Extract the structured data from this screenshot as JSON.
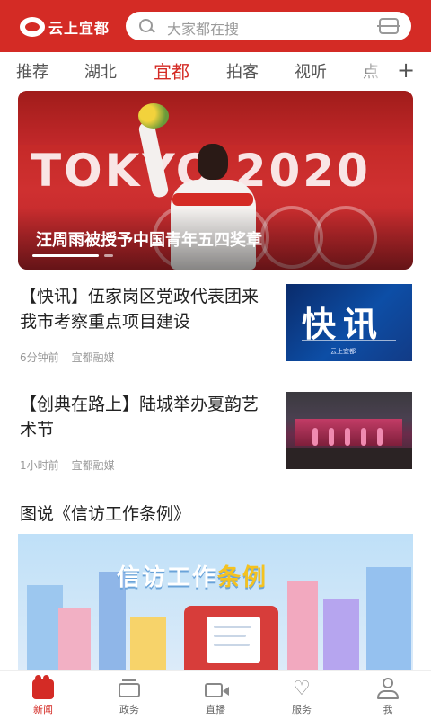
{
  "header": {
    "logo_text": "云上宜都",
    "search_placeholder": "大家都在搜",
    "brand_color": "#d42b25"
  },
  "tabs": [
    {
      "label": "推荐",
      "active": false
    },
    {
      "label": "湖北",
      "active": false
    },
    {
      "label": "宜都",
      "active": true
    },
    {
      "label": "拍客",
      "active": false
    },
    {
      "label": "视听",
      "active": false
    },
    {
      "label": "点",
      "active": false
    }
  ],
  "tabs_more": "+",
  "hero": {
    "image_text": "TOKYO 2020",
    "title": "汪周雨被授予中国青年五四奖章"
  },
  "news": [
    {
      "title": "【快讯】伍家岗区党政代表团来我市考察重点项目建设",
      "time": "6分钟前",
      "source": "宜都融媒",
      "thumb_text": "快讯",
      "thumb_sub": "云上宜都"
    },
    {
      "title": "【创典在路上】陆城举办夏韵艺术节",
      "time": "1小时前",
      "source": "宜都融媒"
    }
  ],
  "section": {
    "title": "图说《信访工作条例》",
    "banner_text_a": "信访工作",
    "banner_text_b": "条例"
  },
  "bottom_nav": [
    {
      "label": "新闻",
      "icon": "news-camera-icon",
      "active": true
    },
    {
      "label": "政务",
      "icon": "gov-icon",
      "active": false
    },
    {
      "label": "直播",
      "icon": "live-video-icon",
      "active": false
    },
    {
      "label": "服务",
      "icon": "heart-icon",
      "active": false
    },
    {
      "label": "我",
      "icon": "user-icon",
      "active": false
    }
  ]
}
